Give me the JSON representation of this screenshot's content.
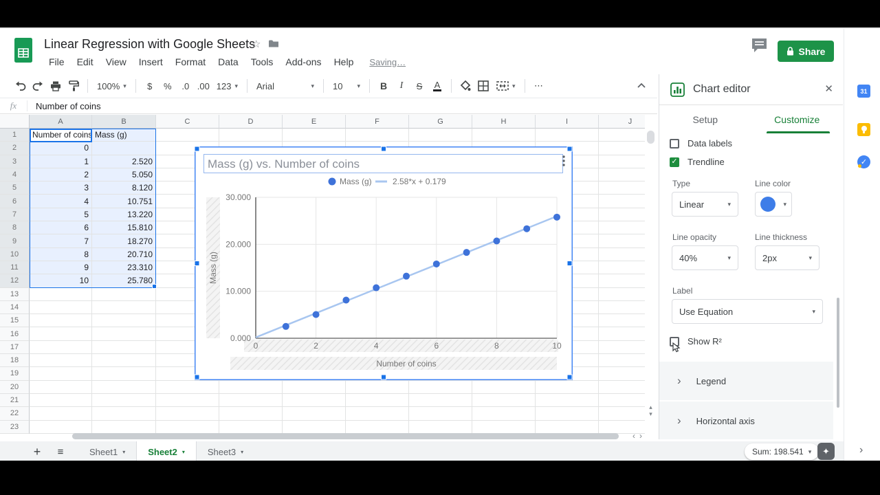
{
  "header": {
    "doc_title": "Linear Regression with Google Sheets",
    "menus": [
      "File",
      "Edit",
      "View",
      "Insert",
      "Format",
      "Data",
      "Tools",
      "Add-ons",
      "Help"
    ],
    "saving": "Saving…",
    "share": "Share"
  },
  "toolbar": {
    "zoom": "100%",
    "currency": "$",
    "percent": "%",
    "decrease_decimal": ".0",
    "increase_decimal": ".00",
    "number_format": "123",
    "font": "Arial",
    "font_size": "10",
    "bold": "B",
    "italic": "I",
    "strikethrough": "S",
    "text_color": "A",
    "more": "⋯"
  },
  "formula_bar": {
    "fx": "fx",
    "value": "Number of coins"
  },
  "grid": {
    "columns": [
      "A",
      "B",
      "C",
      "D",
      "E",
      "F",
      "G",
      "H",
      "I",
      "J"
    ],
    "selected_columns": [
      "A",
      "B"
    ],
    "rows_visible": 23,
    "selected_rows": 12
  },
  "table": {
    "headers": [
      "Number of coins",
      "Mass (g)"
    ],
    "rows": [
      [
        "0",
        ""
      ],
      [
        "1",
        "2.520"
      ],
      [
        "2",
        "5.050"
      ],
      [
        "3",
        "8.120"
      ],
      [
        "4",
        "10.751"
      ],
      [
        "5",
        "13.220"
      ],
      [
        "6",
        "15.810"
      ],
      [
        "7",
        "18.270"
      ],
      [
        "8",
        "20.710"
      ],
      [
        "9",
        "23.310"
      ],
      [
        "10",
        "25.780"
      ]
    ]
  },
  "chart_data": {
    "type": "scatter",
    "title": "Mass (g) vs. Number of coins",
    "xlabel": "Number of coins",
    "ylabel": "Mass (g)",
    "series": [
      {
        "name": "Mass (g)",
        "x": [
          1,
          2,
          3,
          4,
          5,
          6,
          7,
          8,
          9,
          10
        ],
        "y": [
          2.52,
          5.05,
          8.12,
          10.751,
          13.22,
          15.81,
          18.27,
          20.71,
          23.31,
          25.78
        ],
        "color": "#3e72d9"
      }
    ],
    "trendline": {
      "label": "2.58*x + 0.179",
      "slope": 2.58,
      "intercept": 0.179,
      "color": "#a8c6f0"
    },
    "xlim": [
      0,
      10
    ],
    "ylim": [
      0,
      30
    ],
    "xticks": [
      0,
      2,
      4,
      6,
      8,
      10
    ],
    "yticks": [
      0,
      10,
      20,
      30
    ],
    "ytick_labels": [
      "0.000",
      "10.000",
      "20.000",
      "30.000"
    ],
    "grid": true,
    "legend_position": "top"
  },
  "chart_editor": {
    "title": "Chart editor",
    "tab_setup": "Setup",
    "tab_customize": "Customize",
    "data_labels_label": "Data labels",
    "data_labels_checked": false,
    "trendline_label": "Trendline",
    "trendline_checked": true,
    "type_label": "Type",
    "type_value": "Linear",
    "line_color_label": "Line color",
    "line_opacity_label": "Line opacity",
    "line_opacity_value": "40%",
    "line_thickness_label": "Line thickness",
    "line_thickness_value": "2px",
    "label_label": "Label",
    "label_value": "Use Equation",
    "show_r2_label": "Show R²",
    "show_r2_checked": false,
    "sections": [
      "Legend",
      "Horizontal axis"
    ]
  },
  "bottom_bar": {
    "sheets": [
      "Sheet1",
      "Sheet2",
      "Sheet3"
    ],
    "active_sheet": "Sheet2",
    "sum": "Sum: 198.541"
  },
  "side_panel_icons": [
    "calendar-icon",
    "keep-icon",
    "tasks-icon"
  ],
  "colors": {
    "accent_blue": "#1a73e8",
    "selection_tint": "#e8f0fe",
    "customize_green": "#188038",
    "share_green": "#1d9348",
    "point_blue": "#3e72d9",
    "trend_blue": "#a8c6f0"
  }
}
